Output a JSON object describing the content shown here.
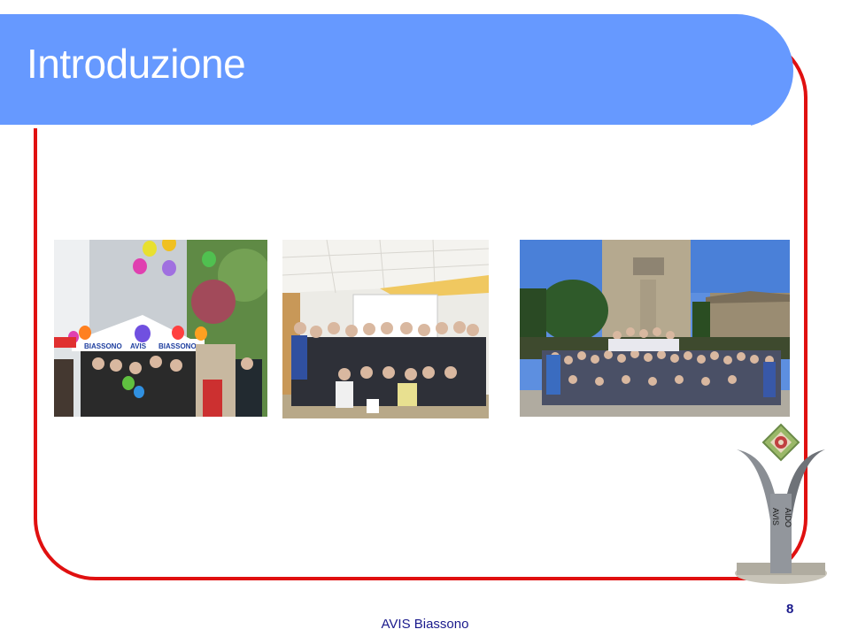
{
  "slide": {
    "title": "Introduzione",
    "footer": "AVIS Biassono",
    "page_number": "8"
  },
  "photo1": {
    "banner_left": "BIASSONO",
    "banner_mid": "AVIS",
    "banner_right": "BIASSONO"
  },
  "logo": {
    "text_left": "AVIS",
    "text_right": "AIDO"
  },
  "colors": {
    "title_bar": "#6699ff",
    "frame": "#e01010",
    "footer_text": "#1a1a8c"
  }
}
